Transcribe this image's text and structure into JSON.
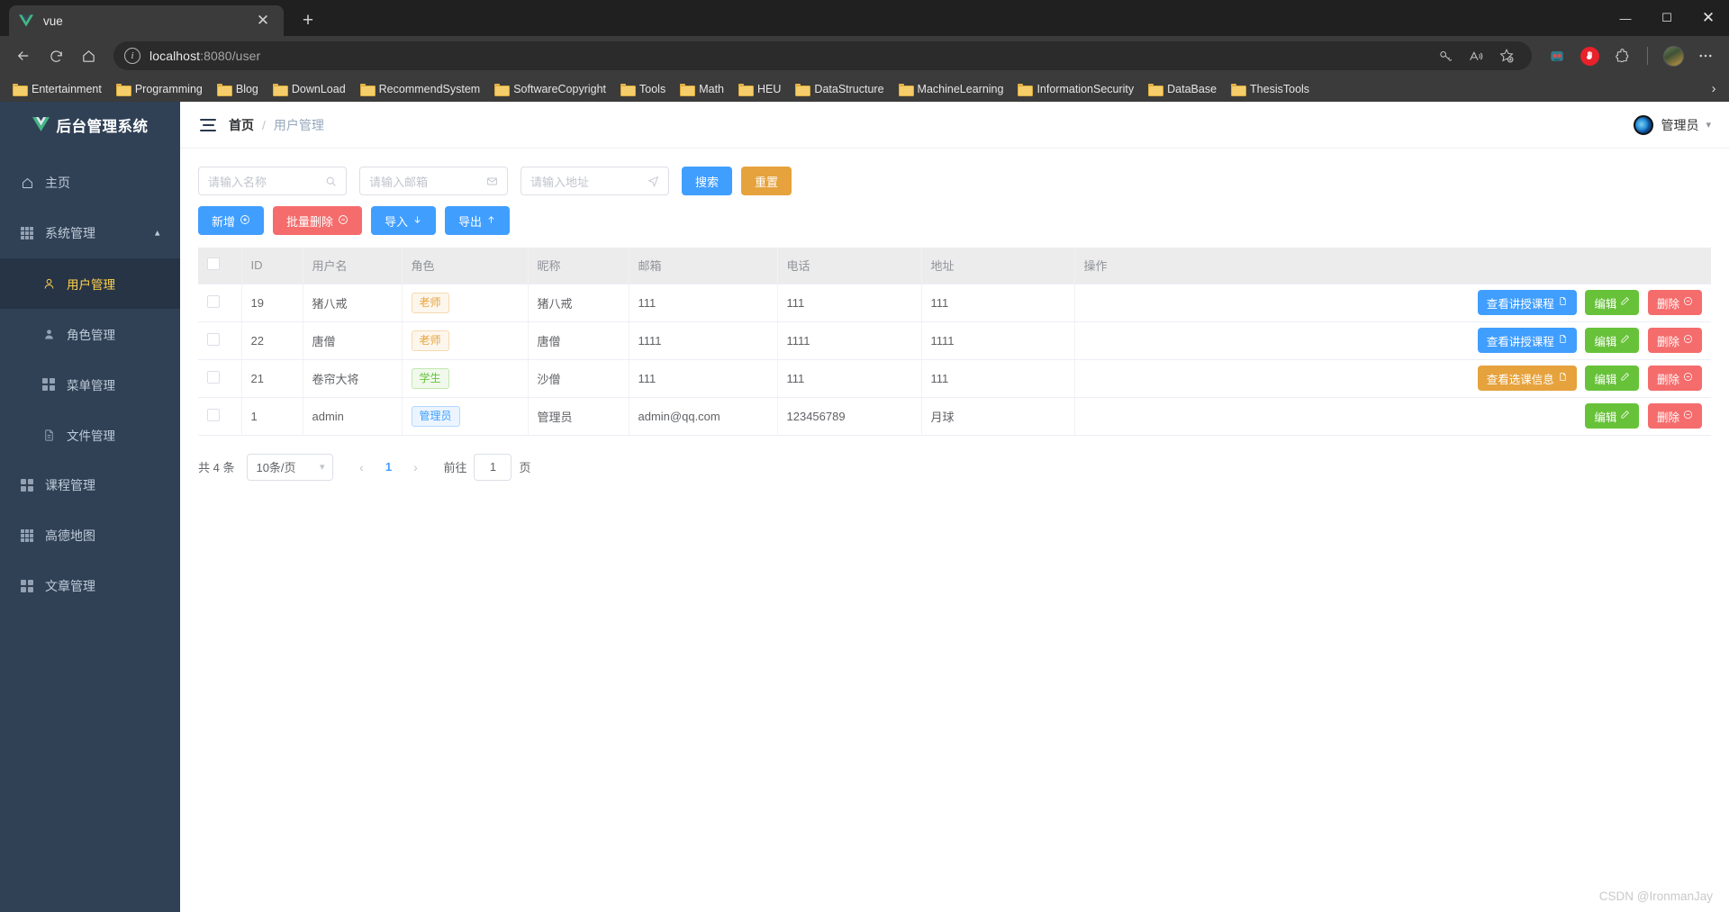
{
  "browser": {
    "tab": {
      "title": "vue",
      "favicon_icon": "vue-logo-icon",
      "close_icon": "close-icon"
    },
    "new_tab_label": "+",
    "window_controls": {
      "minimize": "—",
      "maximize": "☐",
      "close": "✕"
    },
    "nav": {
      "back_icon": "back-arrow-icon",
      "reload_icon": "reload-icon",
      "home_icon": "home-icon"
    },
    "omnibox": {
      "info_icon": "info-icon",
      "url_host": "localhost",
      "url_path": ":8080/user",
      "full_url": "localhost:8080/user"
    },
    "toolbar_icons": [
      {
        "name": "key-icon"
      },
      {
        "name": "read-aloud-icon"
      },
      {
        "name": "add-favorite-icon"
      },
      {
        "name": "extension-robot-icon"
      },
      {
        "name": "adblock-stop-hand-icon"
      },
      {
        "name": "extension-puzzle-icon"
      },
      {
        "name": "profile-avatar-icon"
      },
      {
        "name": "more-options-icon"
      }
    ],
    "bookmarks": [
      "Entertainment",
      "Programming",
      "Blog",
      "DownLoad",
      "RecommendSystem",
      "SoftwareCopyright",
      "Tools",
      "Math",
      "HEU",
      "DataStructure",
      "MachineLearning",
      "InformationSecurity",
      "DataBase",
      "ThesisTools"
    ],
    "bookmarks_overflow_icon": "chevron-right-icon"
  },
  "sidebar": {
    "logo_text": "后台管理系统",
    "logo_icon": "vue-logo-icon",
    "items": [
      {
        "label": "主页",
        "icon": "home-outline-icon",
        "level": "top",
        "active": false
      },
      {
        "label": "系统管理",
        "icon": "grid9-icon",
        "level": "top",
        "active": false,
        "expanded": true
      },
      {
        "label": "用户管理",
        "icon": "user-icon",
        "level": "sub",
        "active": true
      },
      {
        "label": "角色管理",
        "icon": "avatar-icon",
        "level": "sub",
        "active": false
      },
      {
        "label": "菜单管理",
        "icon": "grid4-icon",
        "level": "sub",
        "active": false
      },
      {
        "label": "文件管理",
        "icon": "document-icon",
        "level": "sub",
        "active": false
      },
      {
        "label": "课程管理",
        "icon": "grid4-icon",
        "level": "top",
        "active": false
      },
      {
        "label": "高德地图",
        "icon": "grid9-icon",
        "level": "top",
        "active": false
      },
      {
        "label": "文章管理",
        "icon": "grid4-icon",
        "level": "top",
        "active": false
      }
    ]
  },
  "topbar": {
    "hamburger_icon": "menu-collapse-icon",
    "breadcrumb_home": "首页",
    "breadcrumb_sep": "/",
    "breadcrumb_current": "用户管理",
    "user_name": "管理员",
    "user_avatar_icon": "edge-avatar-icon",
    "caret_icon": "chevron-down-icon"
  },
  "filters": {
    "name_placeholder": "请输入名称",
    "name_value": "",
    "name_icon": "search-icon",
    "email_placeholder": "请输入邮箱",
    "email_value": "",
    "email_icon": "envelope-icon",
    "address_placeholder": "请输入地址",
    "address_value": "",
    "address_icon": "location-send-icon",
    "search_label": "搜索",
    "reset_label": "重置"
  },
  "operations": {
    "add_label": "新增",
    "add_icon": "circle-plus-icon",
    "batch_delete_label": "批量删除",
    "batch_delete_icon": "circle-minus-icon",
    "import_label": "导入",
    "import_icon": "arrow-down-icon",
    "export_label": "导出",
    "export_icon": "arrow-up-icon"
  },
  "table": {
    "columns": [
      "",
      "ID",
      "用户名",
      "角色",
      "昵称",
      "邮箱",
      "电话",
      "地址",
      "操作"
    ],
    "header_checkbox_icon": "checkbox-icon",
    "rows": [
      {
        "id": "19",
        "username": "猪八戒",
        "role": "老师",
        "role_type": "warn",
        "nickname": "猪八戒",
        "email": "111",
        "phone": "111",
        "address": "111",
        "primary_action": {
          "label": "查看讲授课程",
          "icon": "document-icon",
          "style": "primary"
        },
        "edit_label": "编辑",
        "edit_icon": "pencil-icon",
        "delete_label": "删除",
        "delete_icon": "circle-minus-icon"
      },
      {
        "id": "22",
        "username": "唐僧",
        "role": "老师",
        "role_type": "warn",
        "nickname": "唐僧",
        "email": "1111",
        "phone": "1111",
        "address": "1111",
        "primary_action": {
          "label": "查看讲授课程",
          "icon": "document-icon",
          "style": "primary"
        },
        "edit_label": "编辑",
        "edit_icon": "pencil-icon",
        "delete_label": "删除",
        "delete_icon": "circle-minus-icon"
      },
      {
        "id": "21",
        "username": "卷帘大将",
        "role": "学生",
        "role_type": "succ",
        "nickname": "沙僧",
        "email": "111",
        "phone": "111",
        "address": "111",
        "primary_action": {
          "label": "查看选课信息",
          "icon": "document-icon",
          "style": "warning"
        },
        "edit_label": "编辑",
        "edit_icon": "pencil-icon",
        "delete_label": "删除",
        "delete_icon": "circle-minus-icon"
      },
      {
        "id": "1",
        "username": "admin",
        "role": "管理员",
        "role_type": "info",
        "nickname": "管理员",
        "email": "admin@qq.com",
        "phone": "123456789",
        "address": "月球",
        "primary_action": null,
        "edit_label": "编辑",
        "edit_icon": "pencil-icon",
        "delete_label": "删除",
        "delete_icon": "circle-minus-icon"
      }
    ]
  },
  "pagination": {
    "total_text": "共 4 条",
    "page_size": "10条/页",
    "prev_icon": "chevron-left-icon",
    "next_icon": "chevron-right-icon",
    "current_page": "1",
    "jump_label": "前往",
    "jump_value": "1",
    "jump_suffix": "页"
  },
  "watermark": "CSDN @IronmanJay",
  "colors": {
    "sidebar_bg": "#304156",
    "sidebar_active_bg": "#263445",
    "active_text": "#ffd04b",
    "primary": "#409eff",
    "warning": "#e6a23c",
    "danger": "#f56c6c",
    "success": "#67c23a"
  }
}
